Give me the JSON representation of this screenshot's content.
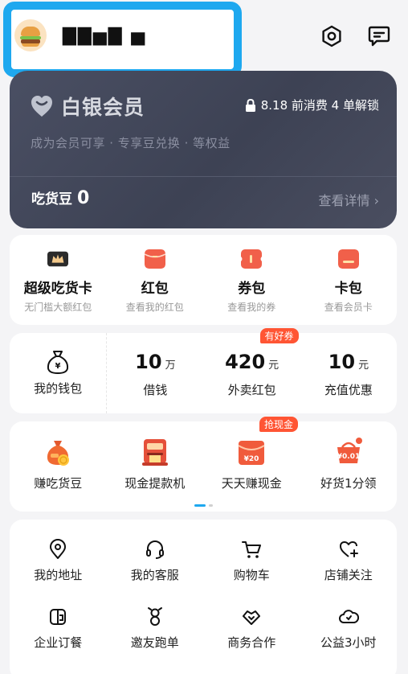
{
  "header": {
    "username": "▇▇▅▇ ▅",
    "settings_icon": "settings-hexagon-icon",
    "message_icon": "message-icon"
  },
  "vip": {
    "title": "白银会员",
    "unlock_text": "8.18 前消费 4 单解锁",
    "subtitle": "成为会员可享 · 专享豆兑换 · 等权益",
    "beans_label": "吃货豆",
    "beans_value": "0",
    "detail_link": "查看详情 ›"
  },
  "quick_cards": [
    {
      "label": "超级吃货卡",
      "sub": "无门槛大额红包",
      "color": "#2b2b2b"
    },
    {
      "label": "红包",
      "sub": "查看我的红包",
      "color": "#f1604a"
    },
    {
      "label": "券包",
      "sub": "查看我的券",
      "color": "#f1604a"
    },
    {
      "label": "卡包",
      "sub": "查看会员卡",
      "color": "#f1604a"
    }
  ],
  "wallet": [
    {
      "num": "",
      "unit": "",
      "label": "我的钱包"
    },
    {
      "num": "10",
      "unit": "万",
      "label": "借钱"
    },
    {
      "num": "420",
      "unit": "元",
      "label": "外卖红包",
      "badge": "有好券"
    },
    {
      "num": "10",
      "unit": "元",
      "label": "充值优惠"
    }
  ],
  "activities": [
    {
      "label": "赚吃货豆",
      "icon": "coin-bag-icon"
    },
    {
      "label": "现金提款机",
      "icon": "cash-machine-icon"
    },
    {
      "label": "天天赚现金",
      "icon": "red-envelope-icon",
      "badge": "抢现金",
      "tag": "¥20"
    },
    {
      "label": "好货1分领",
      "icon": "shopping-basket-icon",
      "tag": "¥0.01"
    }
  ],
  "tools": [
    [
      {
        "label": "我的地址",
        "icon": "location-pin-icon"
      },
      {
        "label": "我的客服",
        "icon": "headset-icon"
      },
      {
        "label": "购物车",
        "icon": "shopping-cart-icon"
      },
      {
        "label": "店铺关注",
        "icon": "heart-plus-icon"
      }
    ],
    [
      {
        "label": "企业订餐",
        "icon": "enterprise-order-icon"
      },
      {
        "label": "邀友跑单",
        "icon": "invite-runner-icon"
      },
      {
        "label": "商务合作",
        "icon": "handshake-icon"
      },
      {
        "label": "公益3小时",
        "icon": "charity-cloud-icon"
      }
    ]
  ],
  "colors": {
    "accent": "#1ea8ef",
    "red": "#ff5534",
    "vip_bg": "#434859"
  }
}
